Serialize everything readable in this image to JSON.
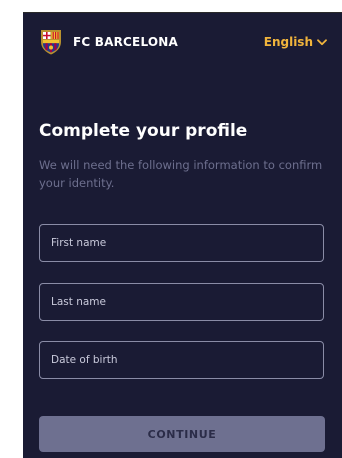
{
  "header": {
    "brand": "FC BARCELONA",
    "language": "English",
    "crest_icon": "fc-barcelona-crest",
    "dropdown_icon": "chevron-down-icon"
  },
  "form": {
    "title": "Complete your profile",
    "subtitle": "We will need the following information to confirm your identity.",
    "fields": [
      {
        "placeholder": "First name"
      },
      {
        "placeholder": "Last name"
      },
      {
        "placeholder": "Date of birth"
      }
    ],
    "submit_label": "CONTINUE"
  },
  "colors": {
    "background": "#1a1b34",
    "accent": "#f0b43c",
    "button": "#6e7090",
    "muted_text": "#6d6f8e",
    "field_border": "#8a8ca6"
  }
}
